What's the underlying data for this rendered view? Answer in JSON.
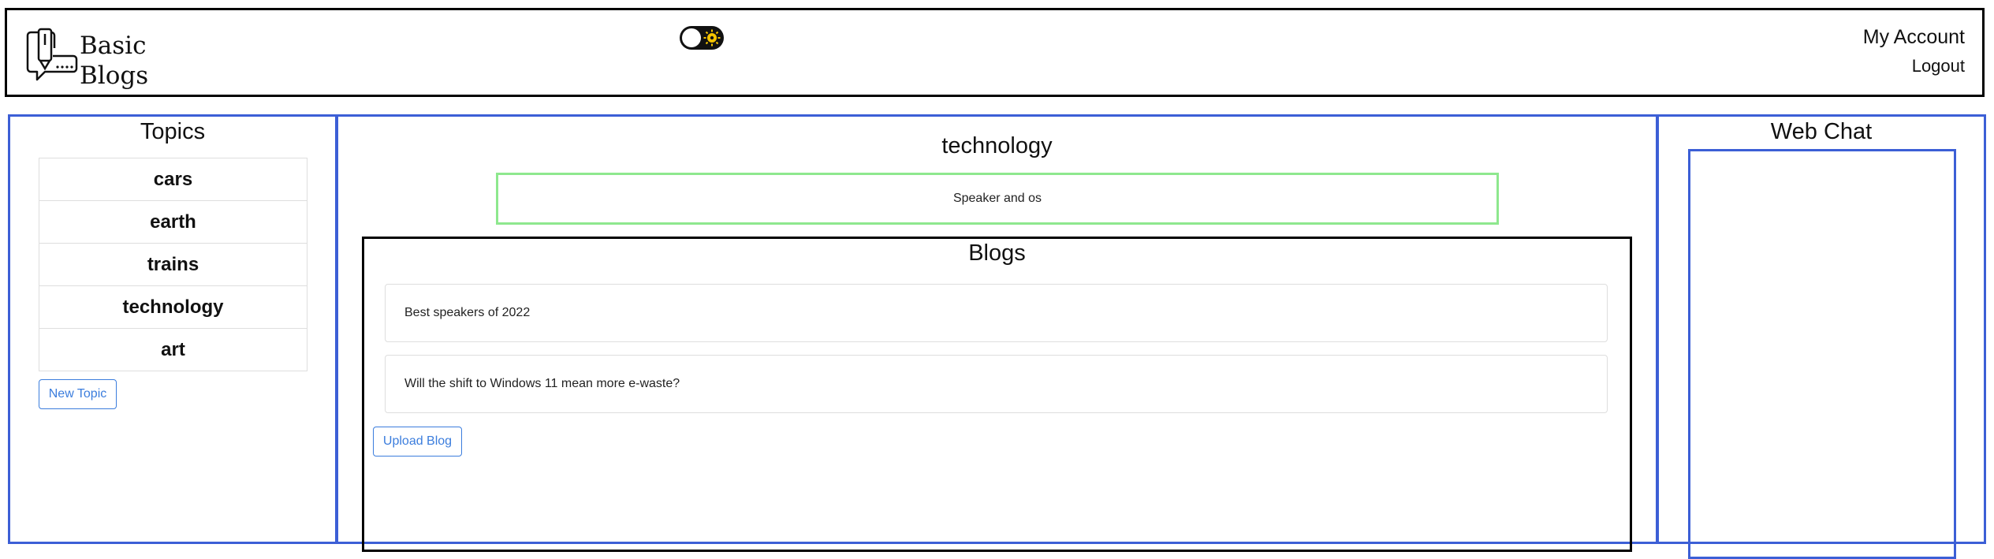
{
  "header": {
    "logo_line1": "Basic",
    "logo_line2": "Blogs",
    "logo_icon": "blog-logo-icon",
    "theme_toggle_icon": "sun-icon",
    "account_link": "My Account",
    "logout_link": "Logout"
  },
  "topics": {
    "title": "Topics",
    "items": [
      "cars",
      "earth",
      "trains",
      "technology",
      "art"
    ],
    "new_topic_button": "New Topic"
  },
  "main": {
    "topic_title": "technology",
    "topic_description": "Speaker and os",
    "blogs_title": "Blogs",
    "blogs": [
      "Best speakers of 2022",
      "Will the shift to Windows 11 mean more e-waste?"
    ],
    "upload_button": "Upload Blog"
  },
  "chat": {
    "title": "Web Chat"
  },
  "colors": {
    "panel_border": "#3c5fd6",
    "button_accent": "#3b7ddd",
    "description_border": "#8ee88e",
    "toggle_sun": "#f5c400"
  }
}
